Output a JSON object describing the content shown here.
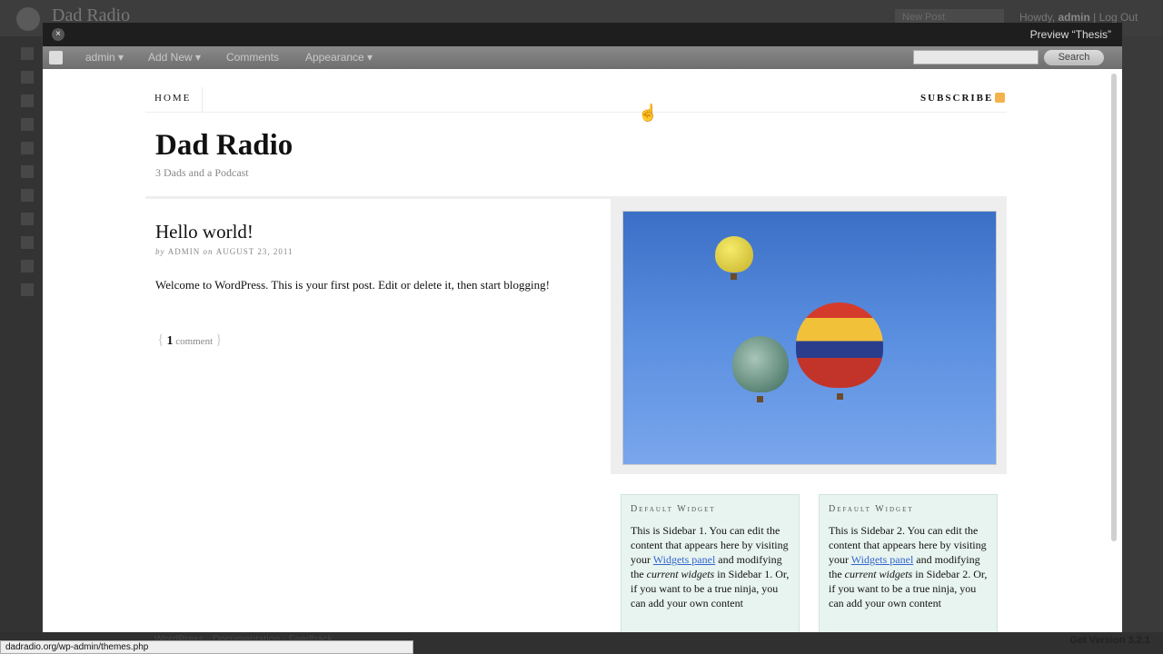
{
  "background_admin": {
    "site_title": "Dad Radio",
    "new_post_select": "New Post",
    "howdy_prefix": "Howdy,",
    "user": "admin",
    "logout": "Log Out",
    "footer_left": "WordPress · Documentation · Feedback",
    "footer_version": "Get Version 3.2.1"
  },
  "preview": {
    "title": "Preview “Thesis”",
    "close_glyph": "×"
  },
  "adminbar": {
    "items": [
      "admin ▾",
      "Add New ▾",
      "Comments",
      "Appearance ▾"
    ],
    "search_button": "Search"
  },
  "site": {
    "nav_home": "HOME",
    "nav_subscribe": "SUBSCRIBE",
    "title": "Dad Radio",
    "tagline": "3 Dads and a Podcast",
    "post": {
      "title": "Hello world!",
      "byline_by": "by",
      "author": "ADMIN",
      "byline_on": "on",
      "date": "AUGUST 23, 2011",
      "body": "Welcome to WordPress. This is your first post. Edit or delete it, then start blogging!",
      "comment_count": "1",
      "comment_label": "comment"
    },
    "widgets": [
      {
        "title": "Default Widget",
        "text_a": "This is Sidebar 1. You can edit the content that appears here by visiting your ",
        "link": "Widgets panel",
        "text_b": " and modifying the ",
        "em": "current widgets",
        "text_c": " in Sidebar 1. Or, if you want to be a true ninja, you can add your own content"
      },
      {
        "title": "Default Widget",
        "text_a": "This is Sidebar 2. You can edit the content that appears here by visiting your ",
        "link": "Widgets panel",
        "text_b": " and modifying the ",
        "em": "current widgets",
        "text_c": " in Sidebar 2. Or, if you want to be a true ninja, you can add your own content"
      }
    ]
  },
  "statusbar": {
    "url": "dadradio.org/wp-admin/themes.php"
  }
}
